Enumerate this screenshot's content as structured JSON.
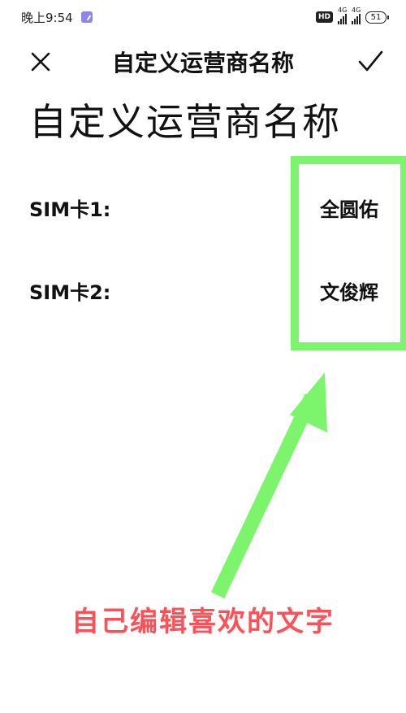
{
  "status_bar": {
    "time": "晚上9:54",
    "hd": "HD",
    "network_1": "4G",
    "network_2": "4G",
    "battery": "51"
  },
  "title_bar": {
    "title": "自定义运营商名称",
    "close_icon": "close-icon",
    "confirm_icon": "check-icon"
  },
  "page": {
    "heading": "自定义运营商名称"
  },
  "sims": [
    {
      "label": "SIM卡1:",
      "value": "全圆佑"
    },
    {
      "label": "SIM卡2:",
      "value": "文俊辉"
    }
  ],
  "annotation": {
    "caption": "自己编辑喜欢的文字",
    "highlight_color": "#7cf56c",
    "caption_color": "#ff4f57"
  }
}
